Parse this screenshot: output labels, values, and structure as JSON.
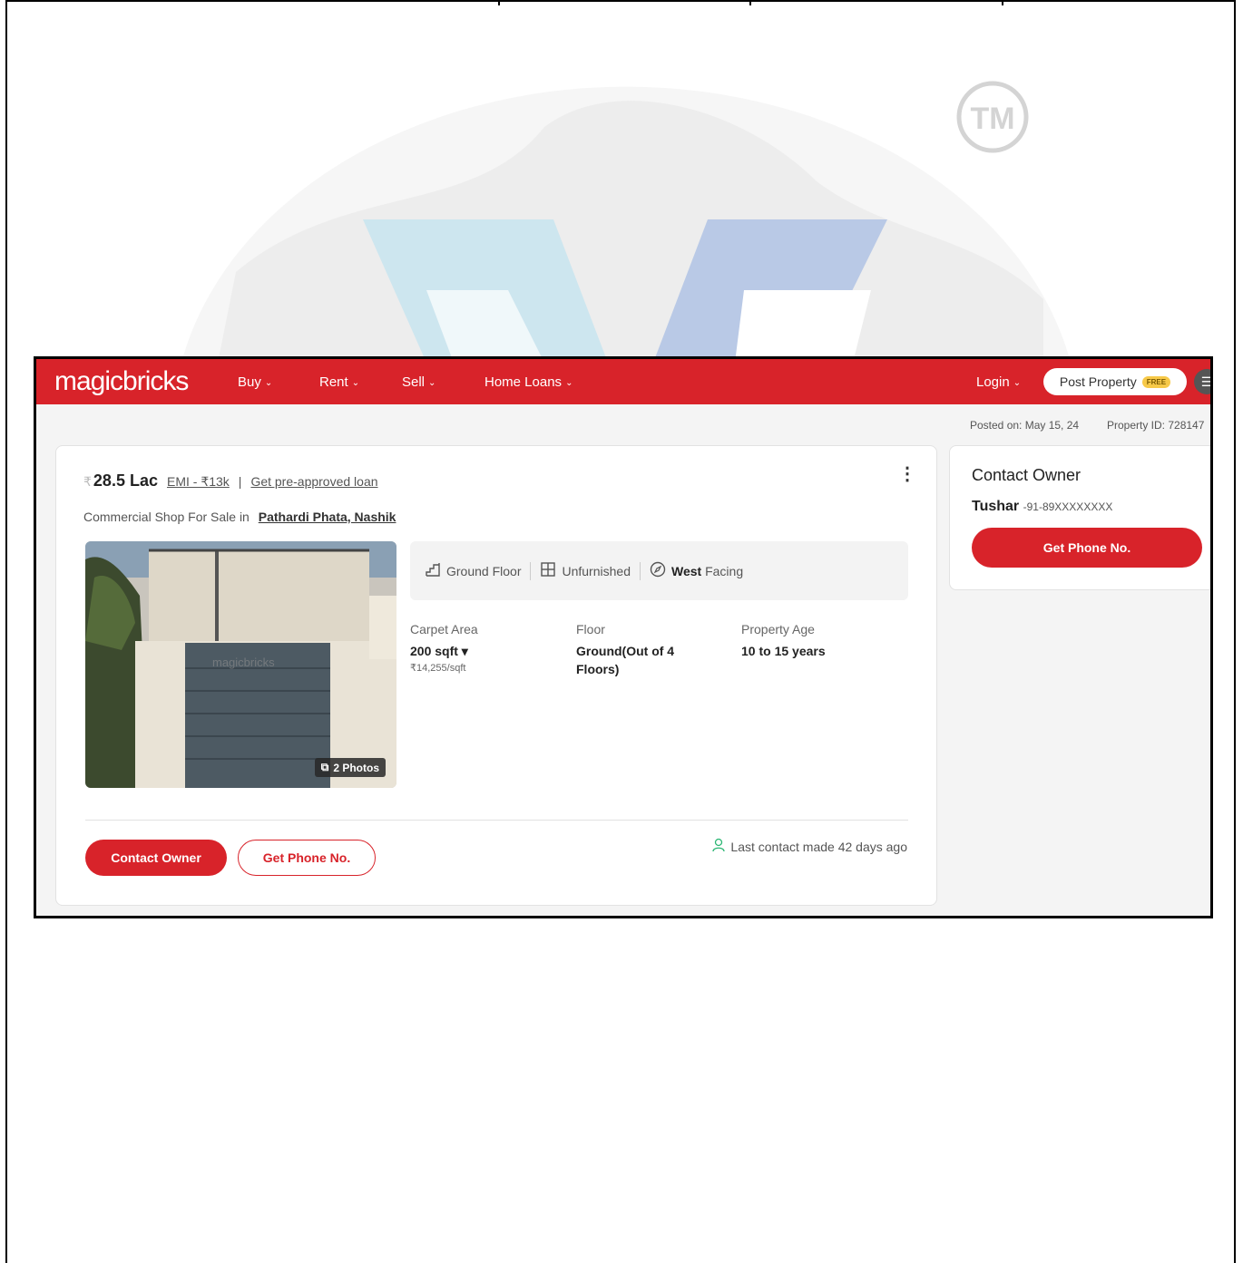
{
  "watermark": {
    "trademark": "TM"
  },
  "nav": {
    "logo": "magicbricks",
    "items": [
      "Buy",
      "Rent",
      "Sell",
      "Home Loans"
    ],
    "login": "Login",
    "post_property": "Post Property",
    "free_badge": "FREE"
  },
  "meta": {
    "posted_on": "Posted on: May 15, 24",
    "property_id": "Property ID: 728147"
  },
  "listing": {
    "price_prefix": "₹",
    "price": "28.5 Lac",
    "emi": "EMI - ₹13k",
    "separator": "|",
    "loan_link": "Get pre-approved loan",
    "kebab": "⋮",
    "subtitle": "Commercial Shop For Sale in",
    "location": "Pathardi Phata, Nashik",
    "photo_badge": "2 Photos",
    "photo_watermark": "magicbricks",
    "features": {
      "floor": "Ground Floor",
      "furnishing": "Unfurnished",
      "facing_dir": "West",
      "facing_word": "Facing"
    },
    "specs": [
      {
        "label": "Carpet Area",
        "value": "200 sqft ▾",
        "sub": "₹14,255/sqft"
      },
      {
        "label": "Floor",
        "value": "Ground(Out of 4 Floors)",
        "sub": ""
      },
      {
        "label": "Property Age",
        "value": "10 to 15 years",
        "sub": ""
      }
    ],
    "contact_owner_btn": "Contact Owner",
    "get_phone_btn": "Get Phone No.",
    "last_contact": "Last contact made 42 days ago"
  },
  "side": {
    "title": "Contact Owner",
    "owner_name": "Tushar",
    "owner_phone": "-91-89XXXXXXXX",
    "get_phone_btn": "Get Phone No."
  },
  "colors": {
    "brand": "#d8232a",
    "badge": "#f7c948"
  }
}
